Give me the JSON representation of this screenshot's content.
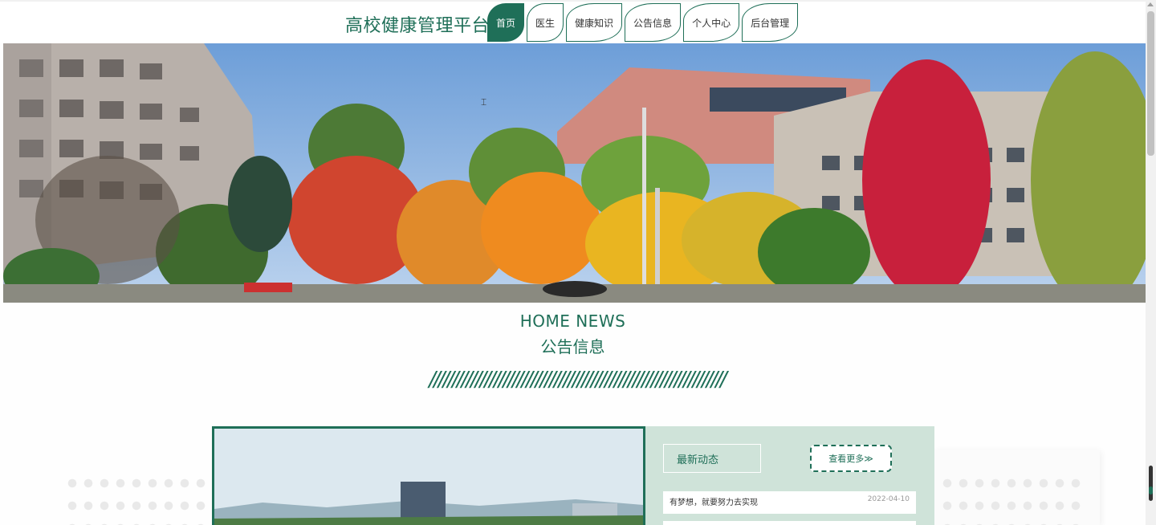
{
  "header": {
    "brand": "高校健康管理平台",
    "nav": [
      {
        "label": "首页",
        "active": true
      },
      {
        "label": "医生",
        "active": false
      },
      {
        "label": "健康知识",
        "active": false
      },
      {
        "label": "公告信息",
        "active": false
      },
      {
        "label": "个人中心",
        "active": false
      },
      {
        "label": "后台管理",
        "active": false
      }
    ]
  },
  "section": {
    "title_en": "HOME NEWS",
    "title_cn": "公告信息",
    "divider": "////////////////////////////////////////////////////////////////"
  },
  "news": {
    "latest_label": "最新动态",
    "more_label": "查看更多≫",
    "items": [
      {
        "title": "有梦想，就要努力去实现",
        "date": "2022-04-10"
      }
    ]
  },
  "colors": {
    "accent": "#1f6f58",
    "panel": "#cfe3d9"
  }
}
